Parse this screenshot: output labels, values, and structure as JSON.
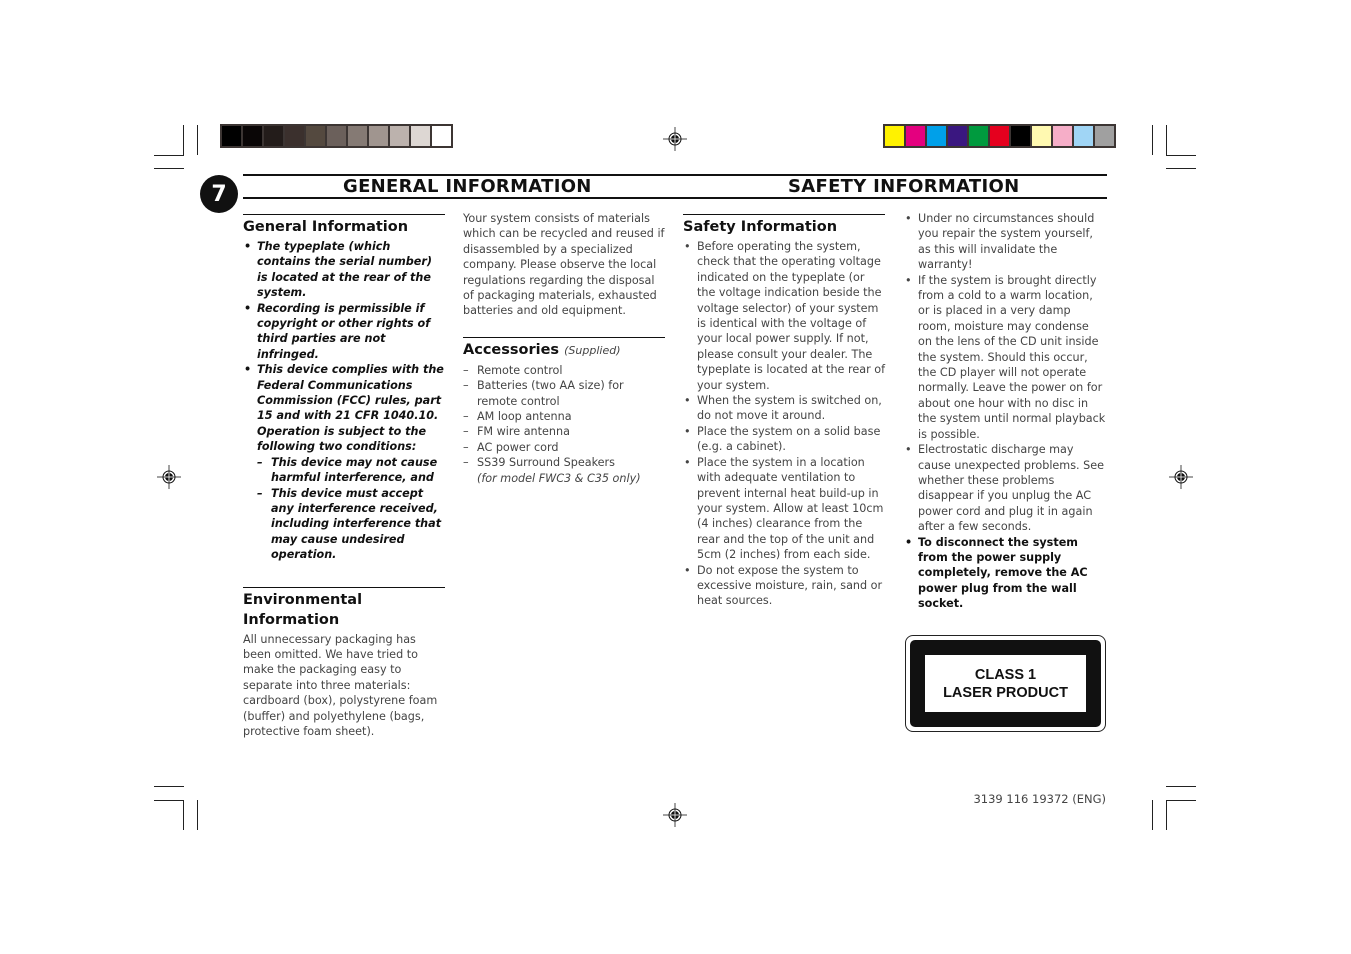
{
  "page": {
    "number": "7",
    "header_left": "GENERAL INFORMATION",
    "header_right": "SAFETY INFORMATION",
    "footer_code": "3139 116 19372 (ENG)"
  },
  "color_bars": {
    "grayscale": [
      "#000000",
      "#0a0606",
      "#231c1a",
      "#3b302d",
      "#54493f",
      "#6b605b",
      "#857a74",
      "#a0958f",
      "#bcb2ad",
      "#ddd7d3",
      "#ffffff"
    ],
    "process": [
      "#fff200",
      "#e4007f",
      "#00a0e9",
      "#3a1780",
      "#009a3e",
      "#e5001e",
      "#000000",
      "#fff9b1",
      "#f6aec8",
      "#a0d5f5",
      "#a0a0a0"
    ]
  },
  "general_information": {
    "title": "General Information",
    "items": [
      "The typeplate (which contains the serial number) is located at the rear of the system.",
      "Recording is permissible if copyright or other rights of third parties are not infringed.",
      "This device complies with the Federal Communications Commission (FCC) rules, part 15 and with 21 CFR 1040.10. Operation is subject to the following two conditions:"
    ],
    "conditions": [
      "This device may not cause harmful interference, and",
      "This device must accept any interference received, including interference that may cause undesired operation."
    ]
  },
  "environmental_information": {
    "title": "Environmental Information",
    "paragraph1": "All unnecessary packaging has been omitted. We have tried to make the packaging easy to separate into three materials: cardboard (box), polystyrene foam (buffer) and polyethylene (bags, protective foam sheet).",
    "paragraph2": "Your system consists of materials which can be recycled and reused if disassembled by a specialized company. Please observe the local regulations regarding the disposal of packaging materials, exhausted batteries and old equipment."
  },
  "accessories": {
    "title": "Accessories",
    "subtitle": "(Supplied)",
    "items": [
      "Remote control",
      "Batteries (two AA size) for remote control",
      "AM loop antenna",
      "FM wire antenna",
      "AC power cord",
      "SS39 Surround Speakers"
    ],
    "note": "(for model FWC3 & C35 only)"
  },
  "safety_information": {
    "title": "Safety Information",
    "items": [
      "Before operating the system, check that the operating voltage indicated on the typeplate (or the voltage indication beside the voltage selector) of your system is identical with the voltage of your local power supply. If not, please consult your dealer. The typeplate is located at the rear of your system.",
      "When the system is switched on, do not move it around.",
      "Place the system on a solid base (e.g. a cabinet).",
      "Place the system in a location with adequate ventilation to prevent internal heat build-up in your system. Allow at least 10cm (4 inches) clearance from the rear and the top of the unit and 5cm (2 inches) from each side.",
      "Do not expose the system to excessive moisture, rain, sand or heat sources.",
      "Under no circumstances should you repair the system yourself, as this will invalidate the warranty!",
      "If the system is brought directly from a cold to a warm location, or is placed in a very damp room, moisture may condense on the lens of the CD unit inside the system. Should this occur, the CD player will not operate normally. Leave the power on for about one hour with no disc in the system until normal playback is possible.",
      "Electrostatic discharge may cause unexpected problems. See whether these problems disappear if you unplug the AC power cord and plug it in again after a few seconds."
    ],
    "warning": "To disconnect the system from the power supply completely, remove the AC power plug from the wall socket."
  },
  "laser_label": {
    "line1": "CLASS 1",
    "line2": "LASER PRODUCT"
  }
}
